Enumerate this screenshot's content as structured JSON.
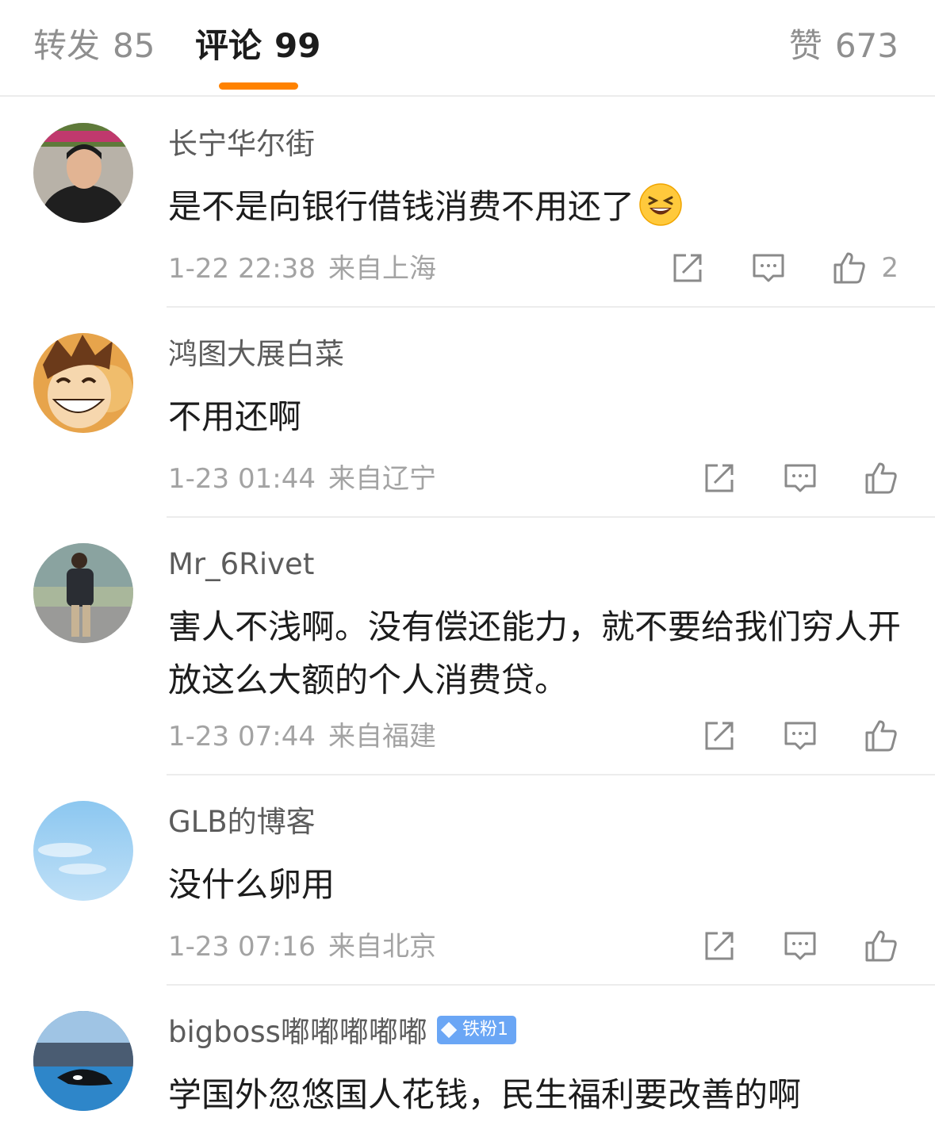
{
  "tabs": {
    "repost": {
      "label": "转发",
      "count": "85"
    },
    "comments": {
      "label": "评论",
      "count": "99"
    },
    "likes": {
      "label": "赞",
      "count": "673"
    }
  },
  "accent_color": "#ff8200",
  "comments": [
    {
      "user": "长宁华尔街",
      "text": "是不是向银行借钱消费不用还了",
      "emoji": "laughing-squint-emoji",
      "time": "1-22 22:38",
      "location": "来自上海",
      "likes": "2"
    },
    {
      "user": "鸿图大展白菜",
      "text": "不用还啊",
      "time": "1-23 01:44",
      "location": "来自辽宁",
      "likes": ""
    },
    {
      "user": "Mr_6Rivet",
      "text": "害人不浅啊。没有偿还能力，就不要给我们穷人开放这么大额的个人消费贷。",
      "time": "1-23 07:44",
      "location": "来自福建",
      "likes": ""
    },
    {
      "user": "GLB的博客",
      "text": "没什么卵用",
      "time": "1-23 07:16",
      "location": "来自北京",
      "likes": ""
    },
    {
      "user": "bigboss嘟嘟嘟嘟嘟",
      "badge": "铁粉1",
      "text": "学国外忽悠国人花钱，民生福利要改善的啊"
    }
  ],
  "icons": {
    "forward": "share-square-icon",
    "reply": "comment-bubble-icon",
    "like": "thumbs-up-icon"
  }
}
